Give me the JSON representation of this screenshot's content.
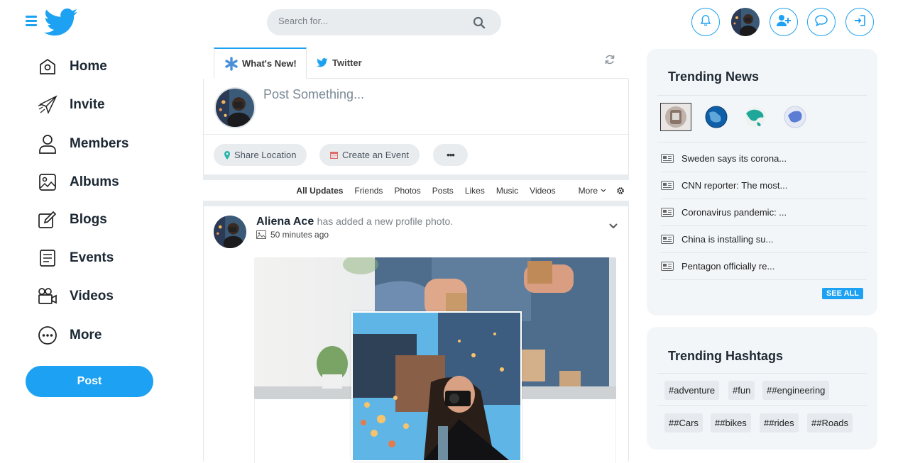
{
  "header": {
    "search_placeholder": "Search for..."
  },
  "sidebar": {
    "items": [
      {
        "label": "Home",
        "icon": "home-icon"
      },
      {
        "label": "Invite",
        "icon": "paper-plane-icon"
      },
      {
        "label": "Members",
        "icon": "user-icon"
      },
      {
        "label": "Albums",
        "icon": "image-icon"
      },
      {
        "label": "Blogs",
        "icon": "edit-icon"
      },
      {
        "label": "Events",
        "icon": "document-icon"
      },
      {
        "label": "Videos",
        "icon": "video-camera-icon"
      },
      {
        "label": "More",
        "icon": "more-circle-icon"
      }
    ],
    "post_button": "Post"
  },
  "feed": {
    "tabs": {
      "whats_new": "What's New!",
      "twitter": "Twitter"
    },
    "composer": {
      "placeholder": "Post Something...",
      "share_location": "Share Location",
      "create_event": "Create an Event",
      "more": "•••"
    },
    "filters": [
      "All Updates",
      "Friends",
      "Photos",
      "Posts",
      "Likes",
      "Music",
      "Videos",
      "More"
    ],
    "post": {
      "author": "Aliena Ace",
      "action": "has added a new profile photo.",
      "time": "50 minutes ago"
    }
  },
  "trending_news": {
    "title": "Trending News",
    "items": [
      "Sweden says its corona...",
      "CNN reporter: The most...",
      "Coronavirus pandemic: ...",
      "China is installing su...",
      "Pentagon officially re..."
    ],
    "see_all": "SEE ALL"
  },
  "trending_hashtags": {
    "title": "Trending Hashtags",
    "row1": [
      "#adventure",
      "#fun",
      "##engineering"
    ],
    "row2": [
      "##Cars",
      "##bikes",
      "##rides",
      "##Roads"
    ]
  },
  "colors": {
    "accent": "#1da1f2",
    "panel_bg": "#f3f6f9",
    "pill_bg": "#e8ecef"
  }
}
